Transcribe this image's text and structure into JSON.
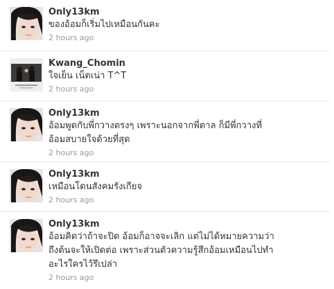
{
  "tweets": [
    {
      "user": "Only13km",
      "avatar": "girl-portrait-avatar",
      "text": "ของอ้อมก็เริ่มไปเหมือนกันคะ",
      "time": "2 hours ago"
    },
    {
      "user": "Kwang_Chomin",
      "avatar": "group-photo-avatar",
      "text": "ใจเย็น เน็ตเน่า T^T",
      "time": "2 hours ago"
    },
    {
      "user": "Only13km",
      "avatar": "girl-portrait-avatar",
      "text": "อ้อมพูดกับพี่กวางตรงๆ เพราะนอกจากพี่ตาล ก็มีพี่กวางที่\nอ้อมสบายใจด้วยที่สุด",
      "time": "2 hours ago"
    },
    {
      "user": "Only13km",
      "avatar": "girl-portrait-avatar",
      "text": "เหมือนโดนสังคมรังเกียจ",
      "time": "2 hours ago"
    },
    {
      "user": "Only13km",
      "avatar": "girl-portrait-avatar",
      "text": "อ้อมคิดว่าถ้าจะปิด อ้อมก็อาจจะเลิก แต่ไม่ได้หมายความว่า\nถึงต้นจะให้เปิดต่อ เพราะส่วนตัวความรู้สึกอ้อมเหมือนไปทำ\nอะไรใครไว้รึเปล่า",
      "time": "2 hours ago"
    }
  ]
}
